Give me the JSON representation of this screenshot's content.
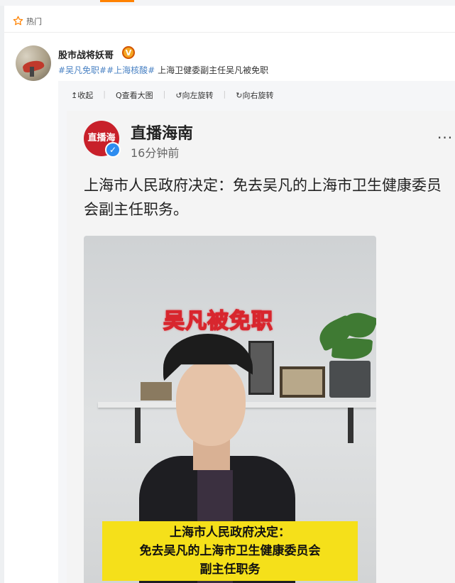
{
  "hot_section": {
    "label": "热门"
  },
  "post": {
    "username": "股市战将妖哥",
    "badge": "V",
    "hashtag1": "#吴凡免职#",
    "hashtag2": "#上海核酸#",
    "text": " 上海卫健委副主任吴凡被免职"
  },
  "toolbar": {
    "collapse": "收起",
    "view_large": "查看大图",
    "rotate_left": "向左旋转",
    "rotate_right": "向右旋转"
  },
  "embedded": {
    "logo_text": "直播海",
    "source_name": "直播海南",
    "time": "16分钟前",
    "more": "...",
    "headline": "上海市人民政府决定：免去吴凡的上海市卫生健康委员会副主任职务。",
    "photo_title": "吴凡被免职",
    "caption_line1": "上海市人民政府决定：",
    "caption_line2": "免去吴凡的上海市卫生健康委员会",
    "caption_line3": "副主任职务"
  },
  "colors": {
    "accent": "#ff8200",
    "link": "#4b83c4",
    "caption_bg": "#f5e01a",
    "title_red": "#d8262e"
  }
}
